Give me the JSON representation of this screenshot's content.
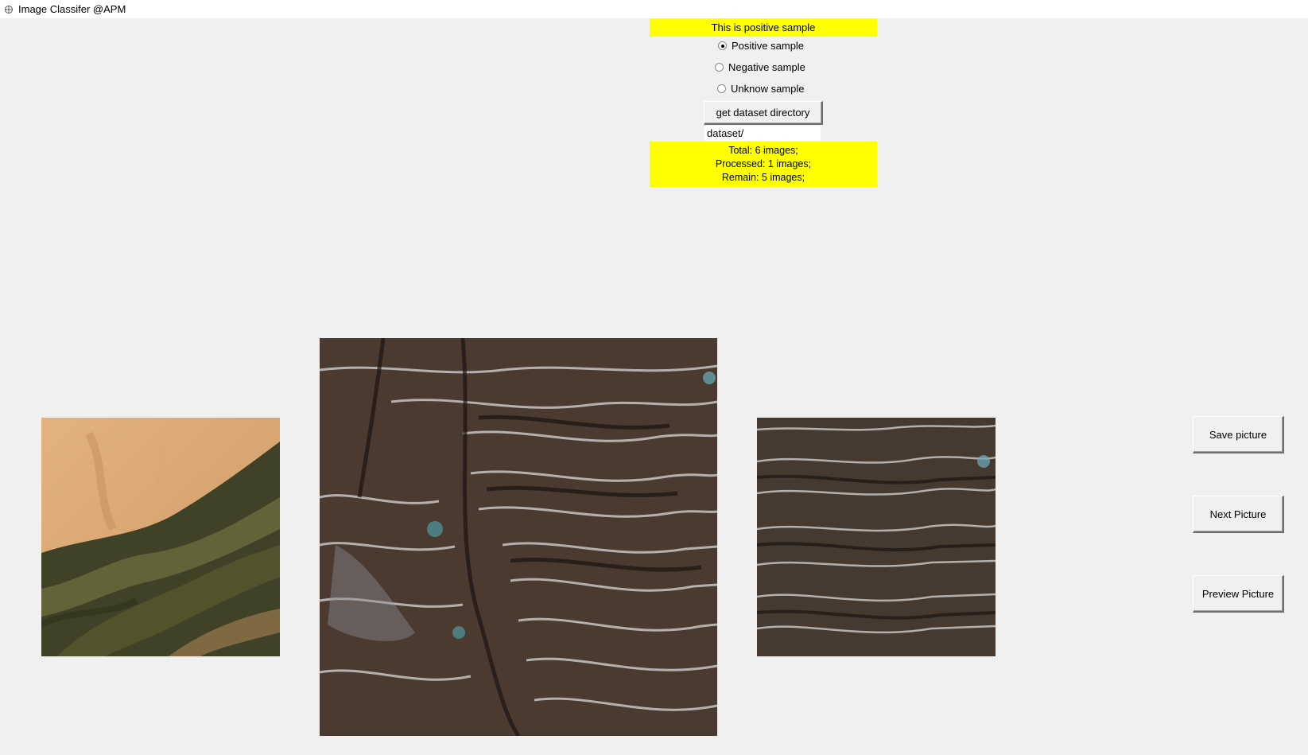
{
  "window": {
    "title": "Image Classifer @APM",
    "icon": "feather-icon"
  },
  "status_banner": {
    "text": "This is positive sample",
    "color": "#ffff00"
  },
  "radios": [
    {
      "label": "Positive sample",
      "checked": true
    },
    {
      "label": "Negative sample",
      "checked": false
    },
    {
      "label": "Unknow sample",
      "checked": false
    }
  ],
  "dataset": {
    "button_label": "get dataset directory",
    "path_value": "dataset/"
  },
  "stats": {
    "total": "Total: 6 images;",
    "processed": "Processed: 1 images;",
    "remain": "Remain: 5 images;"
  },
  "images": {
    "previous": "sandy terrain satellite tile",
    "current": "terraced hillside satellite tile",
    "next": "terraced hillside satellite tile (zoom)"
  },
  "actions": {
    "save": "Save picture",
    "next": "Next Picture",
    "preview": "Preview Picture"
  }
}
